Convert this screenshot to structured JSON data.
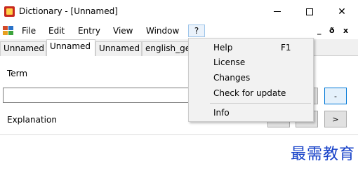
{
  "window": {
    "title": "Dictionary - [Unnamed]",
    "minimize_label": "–",
    "close_label": "✕"
  },
  "menubar": {
    "items": [
      "File",
      "Edit",
      "Entry",
      "View",
      "Window",
      "?"
    ],
    "mdi_minimize": "_",
    "mdi_restore": "ð",
    "mdi_close": "x"
  },
  "tabs": [
    "Unnamed",
    "Unnamed",
    "Unnamed",
    "english_ge"
  ],
  "content": {
    "term_label": "Term",
    "explanation_label": "Explanation",
    "minus_button": "-",
    "next_button": ">",
    "watermark": "最需教育"
  },
  "help_menu": {
    "items": [
      {
        "label": "Help",
        "shortcut": "F1"
      },
      {
        "label": "License",
        "shortcut": ""
      },
      {
        "label": "Changes",
        "shortcut": ""
      },
      {
        "label": "Check for update",
        "shortcut": ""
      },
      {
        "label": "Info",
        "shortcut": ""
      }
    ]
  }
}
